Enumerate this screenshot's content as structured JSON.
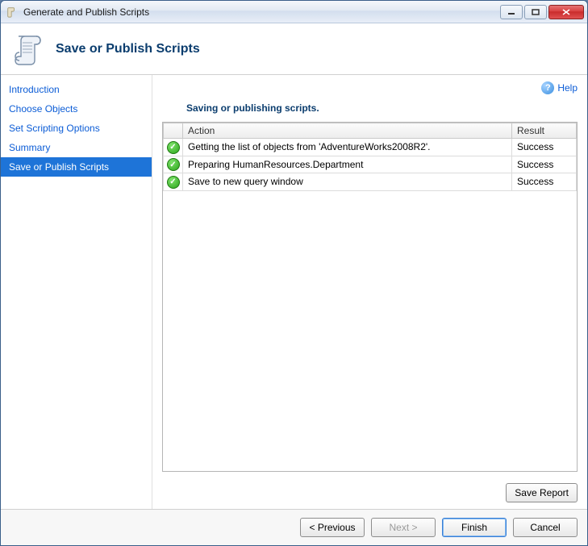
{
  "titlebar": {
    "title": "Generate and Publish Scripts"
  },
  "header": {
    "title": "Save or Publish Scripts"
  },
  "sidebar": {
    "items": [
      {
        "label": "Introduction",
        "selected": false
      },
      {
        "label": "Choose Objects",
        "selected": false
      },
      {
        "label": "Set Scripting Options",
        "selected": false
      },
      {
        "label": "Summary",
        "selected": false
      },
      {
        "label": "Save or Publish Scripts",
        "selected": true
      }
    ]
  },
  "help": {
    "label": "Help"
  },
  "content": {
    "heading": "Saving or publishing scripts.",
    "columns": {
      "action": "Action",
      "result": "Result"
    },
    "rows": [
      {
        "action": "Getting the list of objects from 'AdventureWorks2008R2'.",
        "result": "Success"
      },
      {
        "action": "Preparing HumanResources.Department",
        "result": "Success"
      },
      {
        "action": "Save to new query window",
        "result": "Success"
      }
    ],
    "save_report_label": "Save Report"
  },
  "footer": {
    "previous": "< Previous",
    "next": "Next >",
    "finish": "Finish",
    "cancel": "Cancel"
  }
}
